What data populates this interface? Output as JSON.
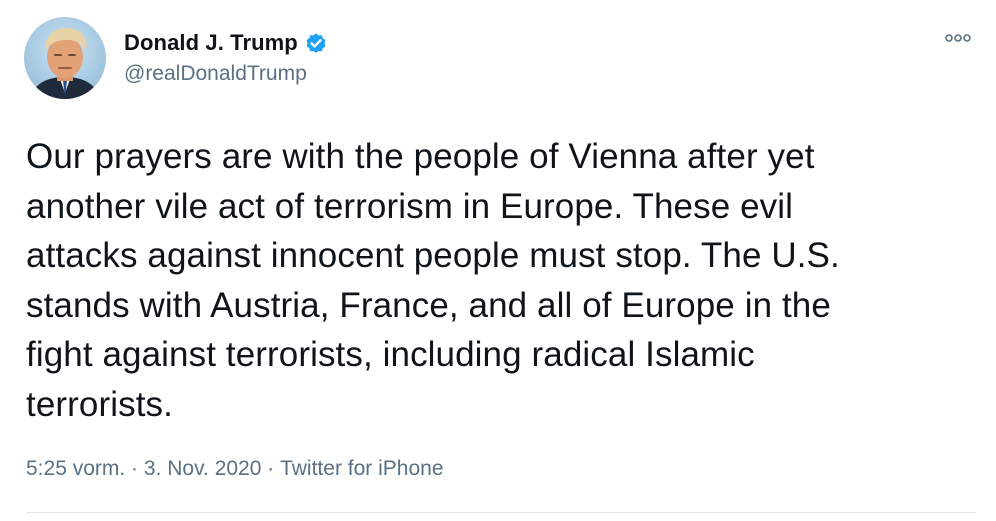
{
  "author": {
    "display_name": "Donald J. Trump",
    "handle": "@realDonaldTrump",
    "verified_icon": "verified-badge-icon",
    "badge_color": "#1da1f2"
  },
  "tweet": {
    "text": "Our prayers are with the people of Vienna after yet\nanother vile act of terrorism in Europe. These evil\nattacks against innocent people must stop. The U.S.\nstands with Austria, France, and all of Europe in the\nfight against terrorists, including radical Islamic\nterrorists."
  },
  "meta": {
    "time": "5:25 vorm.",
    "separator": " · ",
    "date": "3. Nov. 2020",
    "source": "Twitter for iPhone"
  },
  "menu": {
    "icon": "more-options-icon"
  },
  "colors": {
    "text": "#0f1419",
    "secondary": "#5b7083",
    "divider": "#e1e8ed"
  }
}
